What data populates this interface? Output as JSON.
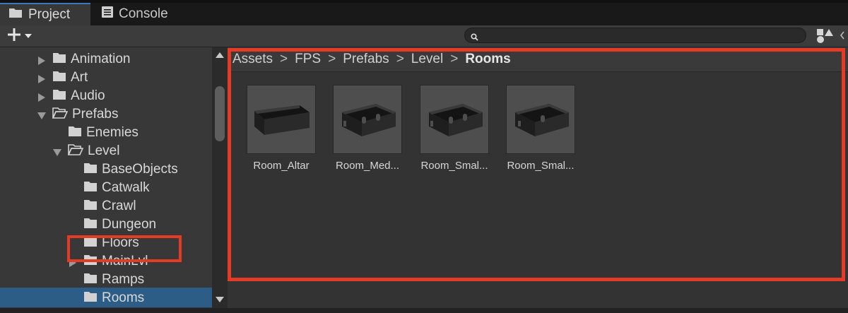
{
  "tabs": [
    {
      "label": "Project",
      "icon": "folder-icon",
      "active": true
    },
    {
      "label": "Console",
      "icon": "console-icon",
      "active": false
    }
  ],
  "toolbar": {
    "add_label": "+",
    "search_value": "",
    "search_placeholder": ""
  },
  "tree": {
    "items": [
      {
        "label": "Animation",
        "expandable": true,
        "expanded": false
      },
      {
        "label": "Art",
        "expandable": true,
        "expanded": false
      },
      {
        "label": "Audio",
        "expandable": true,
        "expanded": false
      },
      {
        "label": "Prefabs",
        "expandable": true,
        "expanded": true
      },
      {
        "label": "Enemies",
        "expandable": false,
        "expanded": false
      },
      {
        "label": "Level",
        "expandable": true,
        "expanded": true
      },
      {
        "label": "BaseObjects",
        "expandable": false,
        "expanded": false
      },
      {
        "label": "Catwalk",
        "expandable": false,
        "expanded": false
      },
      {
        "label": "Crawl",
        "expandable": false,
        "expanded": false
      },
      {
        "label": "Dungeon",
        "expandable": false,
        "expanded": false
      },
      {
        "label": "Floors",
        "expandable": false,
        "expanded": false
      },
      {
        "label": "MainLvl",
        "expandable": true,
        "expanded": false
      },
      {
        "label": "Ramps",
        "expandable": false,
        "expanded": false
      },
      {
        "label": "Rooms",
        "expandable": false,
        "expanded": false,
        "selected": true
      }
    ]
  },
  "breadcrumb": [
    "Assets",
    "FPS",
    "Prefabs",
    "Level",
    "Rooms"
  ],
  "breadcrumb_separator": ">",
  "assets": [
    {
      "label": "Room_Altar",
      "variant": "plain"
    },
    {
      "label": "Room_Med...",
      "variant": "doors"
    },
    {
      "label": "Room_Smal...",
      "variant": "doors"
    },
    {
      "label": "Room_Smal...",
      "variant": "doors-small"
    }
  ],
  "colors": {
    "accent": "#3a79bb",
    "selection": "#2c5d87",
    "annotation": "#e53a24"
  }
}
